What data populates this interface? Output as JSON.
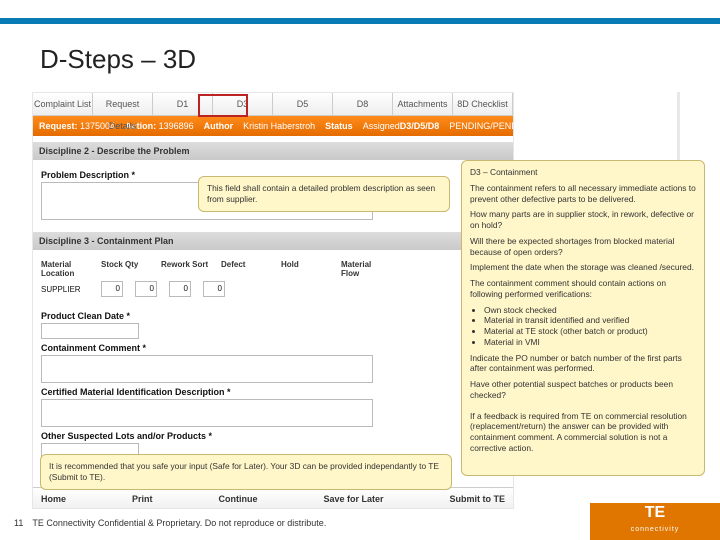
{
  "title": "D-Steps – 3D",
  "tabs": [
    "Complaint List",
    "Request Details",
    "D1",
    "D3",
    "D5",
    "D8",
    "Attachments",
    "8D Checklist"
  ],
  "orange": {
    "request_lbl": "Request:",
    "request_val": "1375004",
    "action_lbl": "Action:",
    "action_val": "1396896",
    "author_lbl": "Author",
    "author_val": "Kristin Haberstroh",
    "status_lbl": "Status",
    "status_val": "Assigned",
    "d_lbl": "D3/D5/D8",
    "d_val": "PENDING/PENDING/PENDING"
  },
  "sections": {
    "d2": "Discipline 2 - Describe the Problem",
    "d3": "Discipline 3 - Containment Plan"
  },
  "labels": {
    "prob": "Problem Description *",
    "matloc": "Material Location",
    "stock": "Stock Qty",
    "rework": "Rework Sort",
    "defect": "Defect",
    "hold": "Hold",
    "flow": "Material Flow",
    "supplier": "SUPPLIER",
    "zero": "0",
    "clean": "Product Clean Date *",
    "comment": "Containment Comment *",
    "cert": "Certified Material Identification Description *",
    "other": "Other Suspected Lots and/or Products *"
  },
  "buttons": [
    "Home",
    "Print",
    "Continue",
    "Save for Later",
    "Submit to TE"
  ],
  "call_small": "This field shall contain a detailed problem description as seen from supplier.",
  "call_big": {
    "h": "D3 – Containment",
    "p1": "The containment refers to all necessary immediate actions to prevent other defective parts to be delivered.",
    "p2": "How many parts are in supplier stock, in rework, defective or on hold?",
    "p3": "Will there be expected shortages from blocked material because of open orders?",
    "p4": "Implement the date when the storage was cleaned /secured.",
    "p5": "The containment comment should contain actions on following performed verifications:",
    "b1": "Own stock checked",
    "b2": "Material in transit identified and verified",
    "b3": "Material at TE stock (other batch or product)",
    "b4": "Material in VMI",
    "p6": "Indicate the PO number or batch number of the first parts after containment was performed.",
    "p7": "Have other potential suspect batches or products been checked?",
    "p8": "If a feedback is required from TE on commercial resolution (replacement/return) the answer can be provided with containment comment. A commercial solution is not a corrective action."
  },
  "call_bot": "It is recommended that you safe your input (Safe for Later). Your 3D can be provided independantly to TE (Submit to TE).",
  "footer": {
    "page": "11",
    "text": "TE Connectivity Confidential & Proprietary. Do not reproduce or distribute."
  },
  "brand": {
    "name": "TE",
    "sub": "connectivity"
  }
}
